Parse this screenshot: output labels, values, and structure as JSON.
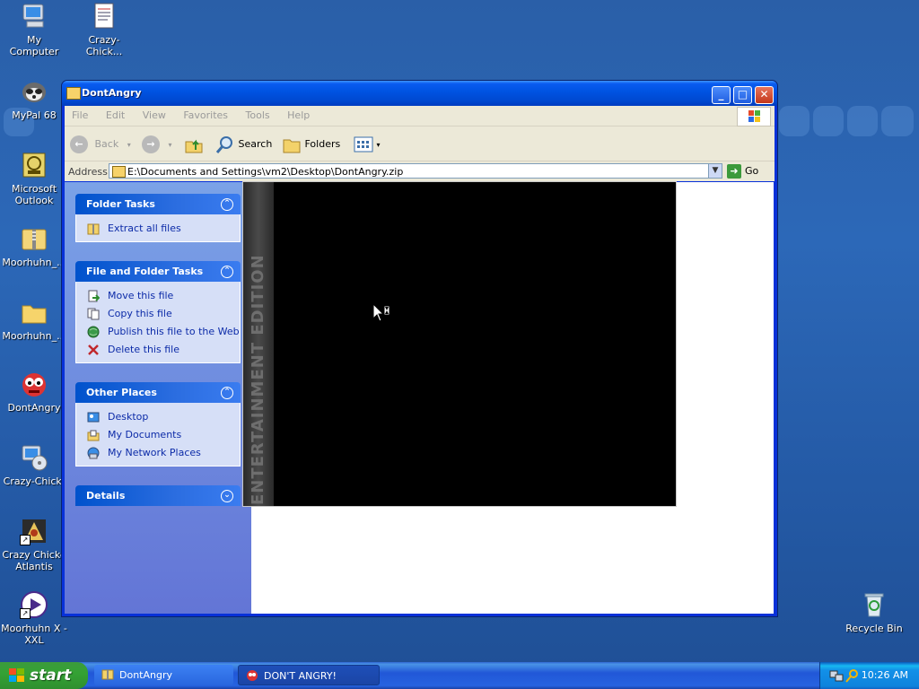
{
  "desktop": {
    "icons": [
      {
        "label": "My Computer"
      },
      {
        "label": "Crazy-Chick..."
      },
      {
        "label": "MyPal 68"
      },
      {
        "label": "Microsoft Outlook"
      },
      {
        "label": "Moorhuhn_..."
      },
      {
        "label": "Moorhuhn_..."
      },
      {
        "label": "DontAngry"
      },
      {
        "label": "Crazy-Chick."
      },
      {
        "label": "Crazy Chicke Atlantis"
      },
      {
        "label": "Moorhuhn X - XXL"
      },
      {
        "label": "Recycle Bin"
      }
    ]
  },
  "window": {
    "title": "DontAngry",
    "minimize": "_",
    "maximize": "□",
    "close": "✕",
    "menu": [
      "File",
      "Edit",
      "View",
      "Favorites",
      "Tools",
      "Help"
    ],
    "toolbar": {
      "back": "Back",
      "search": "Search",
      "folders": "Folders"
    },
    "address": {
      "label": "Address",
      "value": "E:\\Documents and Settings\\vm2\\Desktop\\DontAngry.zip",
      "go": "Go"
    },
    "left_pane": {
      "folder_tasks": {
        "title": "Folder Tasks",
        "items": [
          "Extract all files"
        ]
      },
      "file_folder_tasks": {
        "title": "File and Folder Tasks",
        "items": [
          "Move this file",
          "Copy this file",
          "Publish this file to the Web",
          "Delete this file"
        ]
      },
      "other_places": {
        "title": "Other Places",
        "items": [
          "Desktop",
          "My Documents",
          "My Network Places"
        ]
      },
      "details": {
        "title": "Details"
      }
    }
  },
  "game_splash": {
    "stripe_text": "ENTERTAINMENT EDITION"
  },
  "taskbar": {
    "start": "start",
    "tasks": [
      {
        "label": "DontAngry"
      },
      {
        "label": "DON'T ANGRY!"
      }
    ],
    "clock": "10:26 AM"
  },
  "colors": {
    "desktop_bg": "#2c68b8",
    "title_bar": "#0054e3",
    "task_link": "#0c2ba8",
    "start_green": "#34a234"
  }
}
